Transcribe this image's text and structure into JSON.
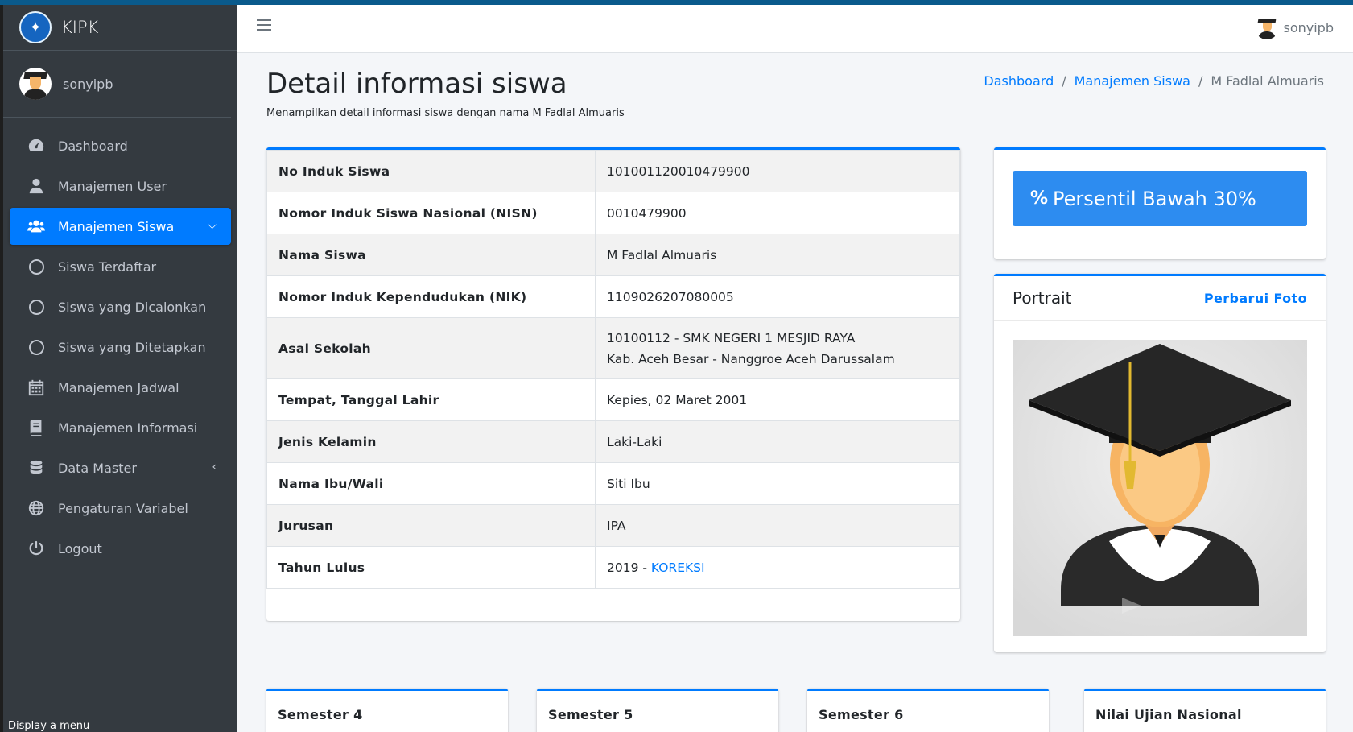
{
  "brand": {
    "name": "KIPK"
  },
  "user": {
    "name": "sonyipb"
  },
  "sidebar": {
    "items": [
      {
        "label": "Dashboard"
      },
      {
        "label": "Manajemen User"
      },
      {
        "label": "Manajemen Siswa"
      },
      {
        "label": "Siswa Terdaftar"
      },
      {
        "label": "Siswa yang Dicalonkan"
      },
      {
        "label": "Siswa yang Ditetapkan"
      },
      {
        "label": "Manajemen Jadwal"
      },
      {
        "label": "Manajemen Informasi"
      },
      {
        "label": "Data Master"
      },
      {
        "label": "Pengaturan Variabel"
      },
      {
        "label": "Logout"
      }
    ],
    "display_menu": "Display a menu"
  },
  "page": {
    "title": "Detail informasi siswa",
    "subtitle": "Menampilkan detail informasi siswa dengan nama M Fadlal Almuaris"
  },
  "breadcrumb": [
    "Dashboard",
    "Manajemen Siswa",
    "M Fadlal Almuaris"
  ],
  "student": {
    "rows": [
      {
        "label": "No Induk Siswa",
        "value": "101001120010479900"
      },
      {
        "label": "Nomor Induk Siswa Nasional (NISN)",
        "value": "0010479900"
      },
      {
        "label": "Nama Siswa",
        "value": "M Fadlal Almuaris"
      },
      {
        "label": "Nomor Induk Kependudukan (NIK)",
        "value": "1109026207080005"
      },
      {
        "label": "Asal Sekolah",
        "value": "10100112 - SMK NEGERI 1 MESJID RAYA",
        "value2": "Kab. Aceh Besar - Nanggroe Aceh Darussalam"
      },
      {
        "label": "Tempat, Tanggal Lahir",
        "value": "Kepies, 02 Maret 2001"
      },
      {
        "label": "Jenis Kelamin",
        "value": "Laki-Laki"
      },
      {
        "label": "Nama Ibu/Wali",
        "value": "Siti Ibu"
      },
      {
        "label": "Jurusan",
        "value": "IPA"
      },
      {
        "label": "Tahun Lulus",
        "value": "2019 - ",
        "link": "KOREKSI"
      }
    ]
  },
  "badge": {
    "icon": "%",
    "label": "Persentil Bawah 30%"
  },
  "portrait": {
    "title": "Portrait",
    "update_label": "Perbarui Foto"
  },
  "semesters": [
    "Semester 4",
    "Semester 5",
    "Semester 6",
    "Nilai Ujian Nasional"
  ]
}
